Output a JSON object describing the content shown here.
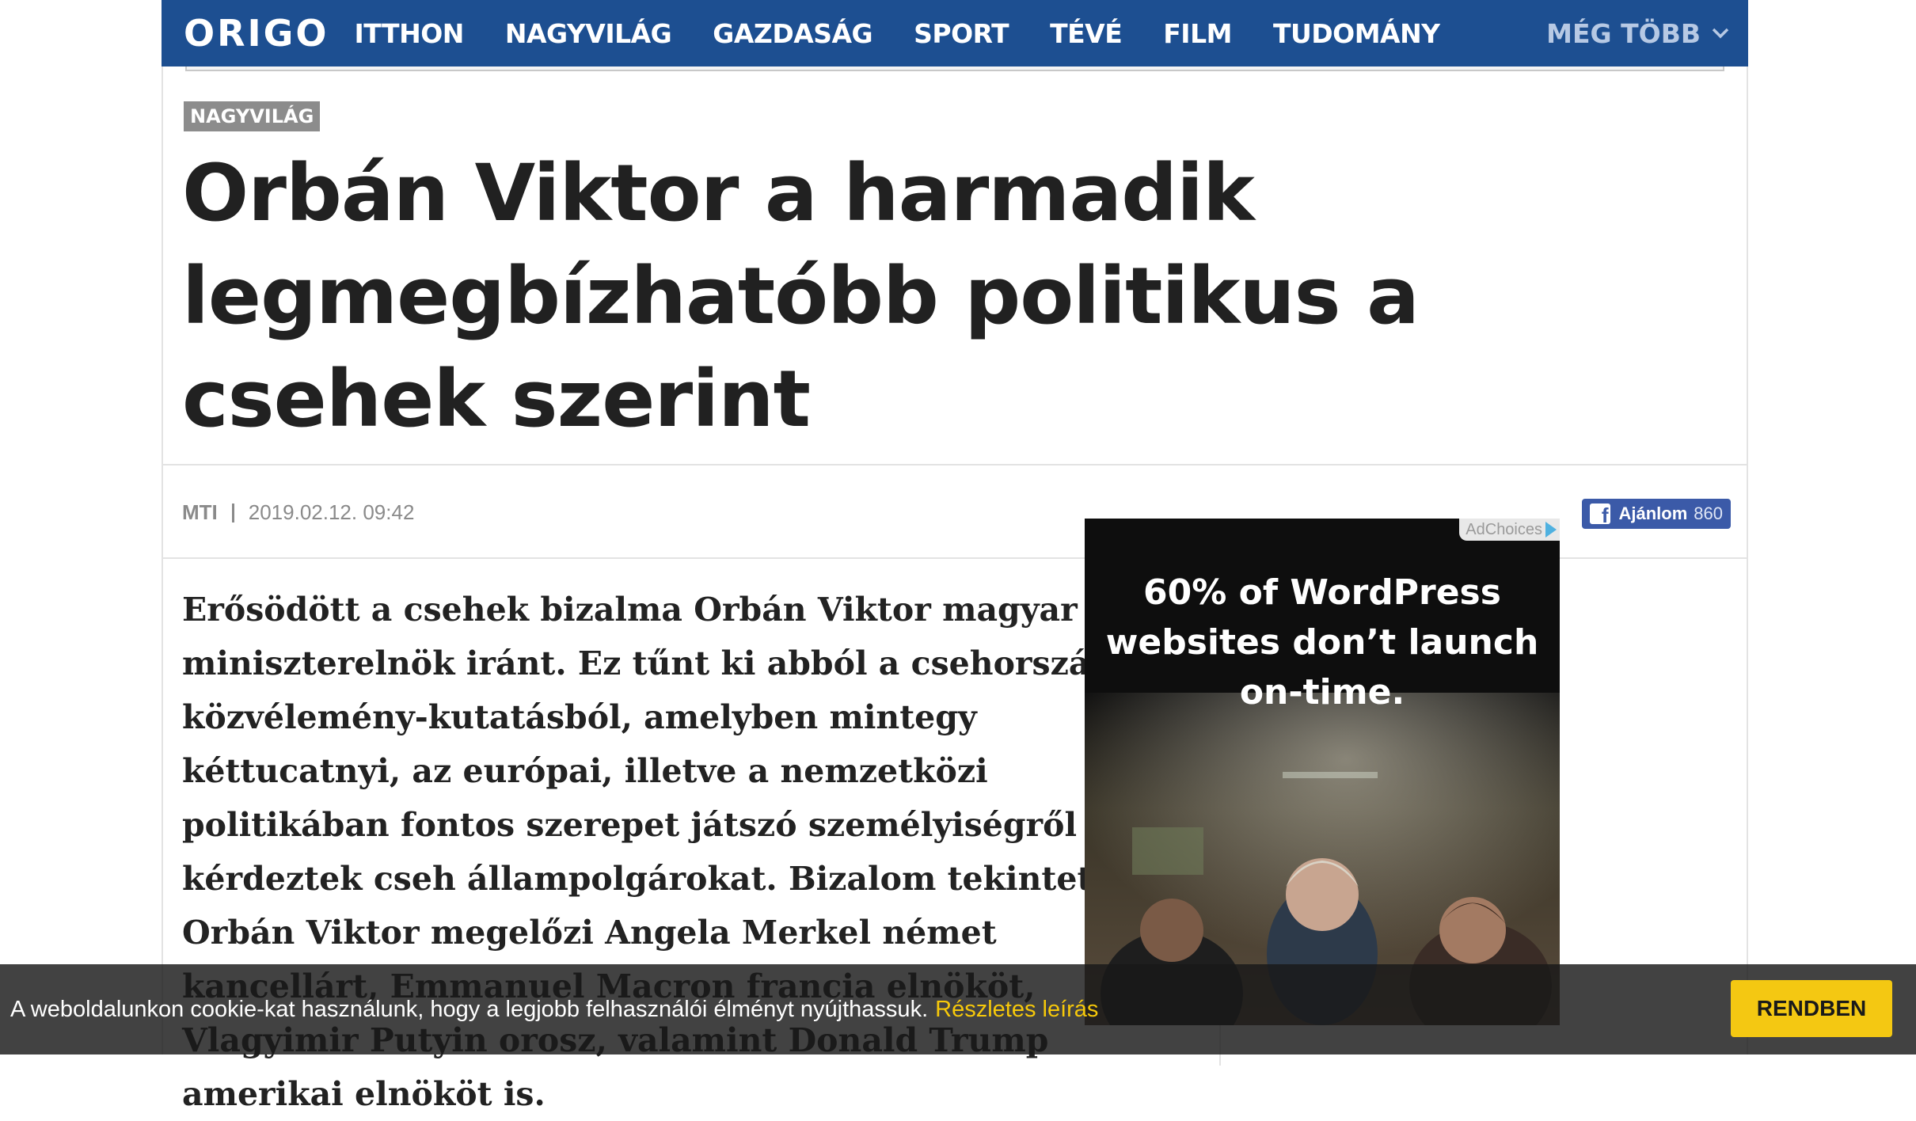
{
  "header": {
    "logo": "ORIGO",
    "nav_items": [
      "ITTHON",
      "NAGYVILÁG",
      "GAZDASÁG",
      "SPORT",
      "TÉVÉ",
      "FILM",
      "TUDOMÁNY"
    ],
    "more_label": "MÉG TÖBB"
  },
  "article": {
    "category": "NAGYVILÁG",
    "title": "Orbán Viktor a harmadik legmegbízhatóbb politikus a csehek szerint",
    "source": "MTI",
    "date": "2019.02.12. 09:42",
    "lead": "Erősödött a csehek bizalma Orbán Viktor magyar miniszterelnök iránt. Ez tűnt ki abból a csehországi közvélemény-kutatásból, amelyben mintegy kéttucatnyi, az európai, illetve a nemzetközi politikában fontos szerepet játszó személyiségről kérdeztek cseh állampolgárokat. Bizalom tekintetében Orbán Viktor megelőzi Angela Merkel német kancellárt, Emmanuel Macron francia elnököt, Vlagyimir Putyin orosz, valamint Donald Trump amerikai elnököt is."
  },
  "facebook": {
    "label": "Ajánlom",
    "count": "860"
  },
  "ad": {
    "adchoices_label": "AdChoices",
    "text": "60% of WordPress websites don’t launch on-time."
  },
  "cookie": {
    "text": "A weboldalunkon cookie-kat használunk, hogy a legjobb felhasználói élményt nyújthassuk.",
    "link": "Részletes leírás",
    "button": "RENDBEN"
  },
  "colors": {
    "nav_bg": "#1d4f91",
    "cookie_accent": "#f4c812",
    "facebook_blue": "#3b5aa8"
  }
}
